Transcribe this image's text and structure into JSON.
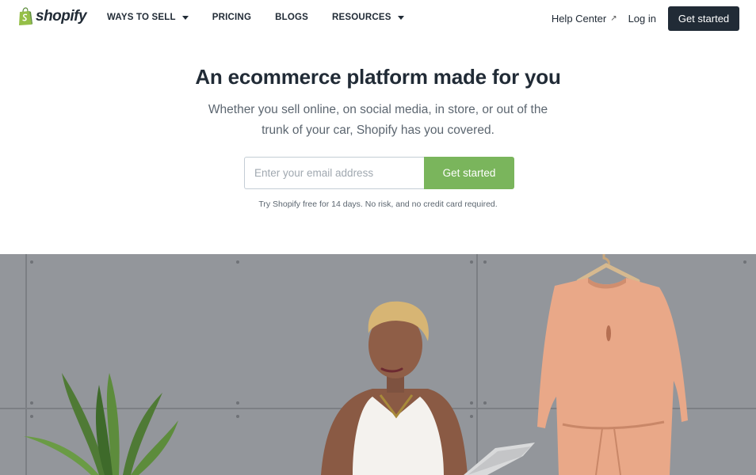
{
  "brand": {
    "name": "shopify",
    "color": "#95bf47"
  },
  "nav": {
    "items": [
      {
        "label": "WAYS TO SELL",
        "has_dropdown": true
      },
      {
        "label": "PRICING",
        "has_dropdown": false
      },
      {
        "label": "BLOGS",
        "has_dropdown": false
      },
      {
        "label": "RESOURCES",
        "has_dropdown": true
      }
    ]
  },
  "header": {
    "help_center": "Help Center",
    "help_center_icon": "external-arrow-icon",
    "login": "Log in",
    "cta": "Get started"
  },
  "hero": {
    "headline": "An ecommerce platform made for you",
    "subtext": "Whether you sell online, on social media, in store, or out of the trunk of your car, Shopify has you covered.",
    "email_placeholder": "Enter your email address",
    "email_value": "",
    "cta": "Get started",
    "trial_note": "Try Shopify free for 14 days. No risk, and no credit card required."
  },
  "colors": {
    "dark_button": "#212b36",
    "green_button": "#7ab55c",
    "text": "#212b36",
    "muted_text": "#5c6670"
  }
}
